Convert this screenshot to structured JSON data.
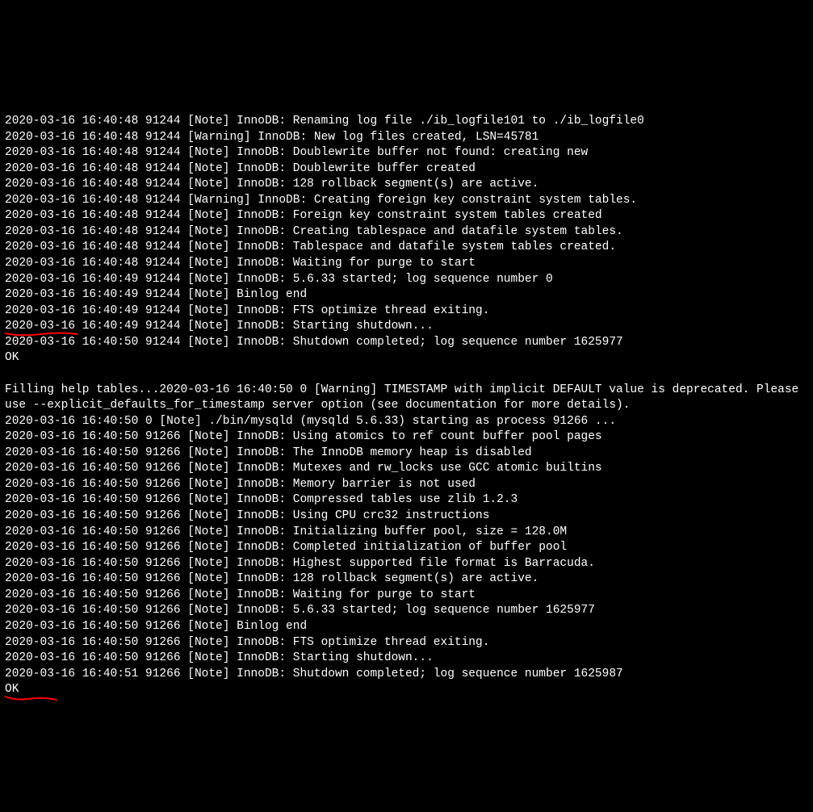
{
  "log_lines": [
    "2020-03-16 16:40:48 91244 [Note] InnoDB: Renaming log file ./ib_logfile101 to ./ib_logfile0",
    "2020-03-16 16:40:48 91244 [Warning] InnoDB: New log files created, LSN=45781",
    "2020-03-16 16:40:48 91244 [Note] InnoDB: Doublewrite buffer not found: creating new",
    "2020-03-16 16:40:48 91244 [Note] InnoDB: Doublewrite buffer created",
    "2020-03-16 16:40:48 91244 [Note] InnoDB: 128 rollback segment(s) are active.",
    "2020-03-16 16:40:48 91244 [Warning] InnoDB: Creating foreign key constraint system tables.",
    "2020-03-16 16:40:48 91244 [Note] InnoDB: Foreign key constraint system tables created",
    "2020-03-16 16:40:48 91244 [Note] InnoDB: Creating tablespace and datafile system tables.",
    "2020-03-16 16:40:48 91244 [Note] InnoDB: Tablespace and datafile system tables created.",
    "2020-03-16 16:40:48 91244 [Note] InnoDB: Waiting for purge to start",
    "2020-03-16 16:40:49 91244 [Note] InnoDB: 5.6.33 started; log sequence number 0",
    "2020-03-16 16:40:49 91244 [Note] Binlog end",
    "2020-03-16 16:40:49 91244 [Note] InnoDB: FTS optimize thread exiting.",
    "2020-03-16 16:40:49 91244 [Note] InnoDB: Starting shutdown...",
    "2020-03-16 16:40:50 91244 [Note] InnoDB: Shutdown completed; log sequence number 1625977",
    "OK",
    "",
    "Filling help tables...2020-03-16 16:40:50 0 [Warning] TIMESTAMP with implicit DEFAULT value is deprecated. Please use --explicit_defaults_for_timestamp server option (see documentation for more details).",
    "2020-03-16 16:40:50 0 [Note] ./bin/mysqld (mysqld 5.6.33) starting as process 91266 ...",
    "2020-03-16 16:40:50 91266 [Note] InnoDB: Using atomics to ref count buffer pool pages",
    "2020-03-16 16:40:50 91266 [Note] InnoDB: The InnoDB memory heap is disabled",
    "2020-03-16 16:40:50 91266 [Note] InnoDB: Mutexes and rw_locks use GCC atomic builtins",
    "2020-03-16 16:40:50 91266 [Note] InnoDB: Memory barrier is not used",
    "2020-03-16 16:40:50 91266 [Note] InnoDB: Compressed tables use zlib 1.2.3",
    "2020-03-16 16:40:50 91266 [Note] InnoDB: Using CPU crc32 instructions",
    "2020-03-16 16:40:50 91266 [Note] InnoDB: Initializing buffer pool, size = 128.0M",
    "2020-03-16 16:40:50 91266 [Note] InnoDB: Completed initialization of buffer pool",
    "2020-03-16 16:40:50 91266 [Note] InnoDB: Highest supported file format is Barracuda.",
    "2020-03-16 16:40:50 91266 [Note] InnoDB: 128 rollback segment(s) are active.",
    "2020-03-16 16:40:50 91266 [Note] InnoDB: Waiting for purge to start",
    "2020-03-16 16:40:50 91266 [Note] InnoDB: 5.6.33 started; log sequence number 1625977",
    "2020-03-16 16:40:50 91266 [Note] Binlog end",
    "2020-03-16 16:40:50 91266 [Note] InnoDB: FTS optimize thread exiting.",
    "2020-03-16 16:40:50 91266 [Note] InnoDB: Starting shutdown...",
    "2020-03-16 16:40:51 91266 [Note] InnoDB: Shutdown completed; log sequence number 1625987",
    "OK"
  ],
  "annotation_color": "#ff0000"
}
